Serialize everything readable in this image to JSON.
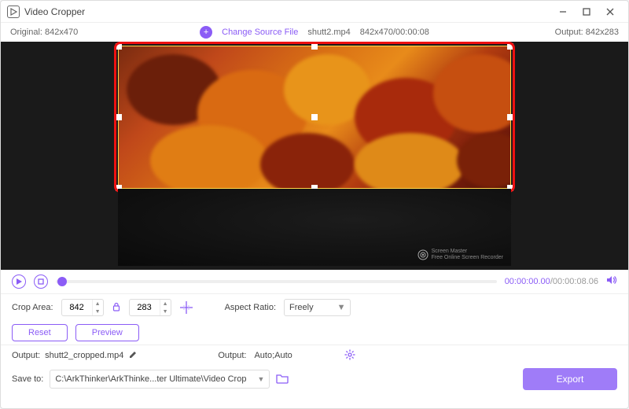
{
  "window": {
    "title": "Video Cropper"
  },
  "info": {
    "original_label": "Original:",
    "original_dim": "842x470",
    "change_source": "Change Source File",
    "filename": "shutt2.mp4",
    "src_spec": "842x470/00:00:08",
    "output_label": "Output:",
    "output_dim": "842x283"
  },
  "watermark": {
    "line1": "Screen Master",
    "line2": "Free Online Screen Recorder"
  },
  "timeline": {
    "current": "00:00:00.00",
    "sep": "/",
    "total": "00:00:08.06"
  },
  "crop": {
    "area_label": "Crop Area:",
    "w": "842",
    "h": "283",
    "aspect_label": "Aspect Ratio:",
    "aspect_value": "Freely"
  },
  "buttons": {
    "reset": "Reset",
    "preview": "Preview",
    "export": "Export"
  },
  "output": {
    "label1": "Output:",
    "filename": "shutt2_cropped.mp4",
    "label2": "Output:",
    "mode": "Auto;Auto"
  },
  "save": {
    "label": "Save to:",
    "path": "C:\\ArkThinker\\ArkThinke...ter Ultimate\\Video Crop"
  }
}
